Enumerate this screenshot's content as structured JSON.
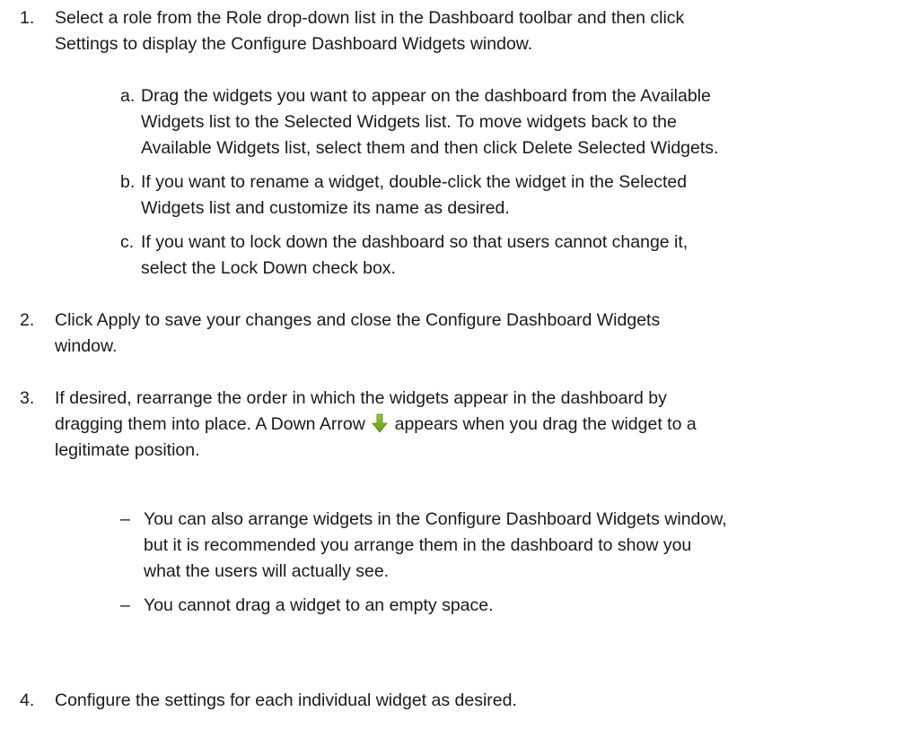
{
  "steps": [
    {
      "number": "1.",
      "lines": [
        "Select a role from the Role drop-down list in the Dashboard toolbar and then click",
        "Settings to display the Configure Dashboard Widgets window."
      ],
      "substeps": [
        {
          "letter": "a.",
          "lines": [
            "Drag the widgets you want to appear on the dashboard from the Available",
            "Widgets list to the Selected Widgets list. To move widgets back to the",
            "Available Widgets list, select them and then click Delete Selected Widgets."
          ]
        },
        {
          "letter": "b.",
          "lines": [
            "If you want to rename a widget, double-click the widget in the Selected",
            "Widgets list and customize its name as desired."
          ]
        },
        {
          "letter": "c.",
          "lines": [
            "If you want to lock down the dashboard so that users cannot change it,",
            "select the Lock Down check box."
          ]
        }
      ]
    },
    {
      "number": "2.",
      "lines": [
        "Click Apply to save your changes and close the Configure Dashboard Widgets",
        "window."
      ]
    },
    {
      "number": "3.",
      "line1": "If desired, rearrange the order in which the widgets appear in the dashboard by",
      "line2_before": "dragging them into place. A Down Arrow ",
      "line2_after": " appears when you drag the widget to a",
      "line3": "legitimate position.",
      "arrow_icon": "down-arrow-icon",
      "arrow_color": "#7ab317",
      "notes": [
        {
          "dash": "–",
          "lines": [
            "You can also arrange widgets in the Configure Dashboard Widgets window,",
            "but it is recommended you arrange them in the dashboard to show you",
            "what the users will actually see."
          ]
        },
        {
          "dash": "–",
          "lines": [
            "You cannot drag a widget to an empty space."
          ]
        }
      ]
    },
    {
      "number": "4.",
      "lines": [
        "Configure the settings for each individual widget as desired."
      ]
    }
  ]
}
